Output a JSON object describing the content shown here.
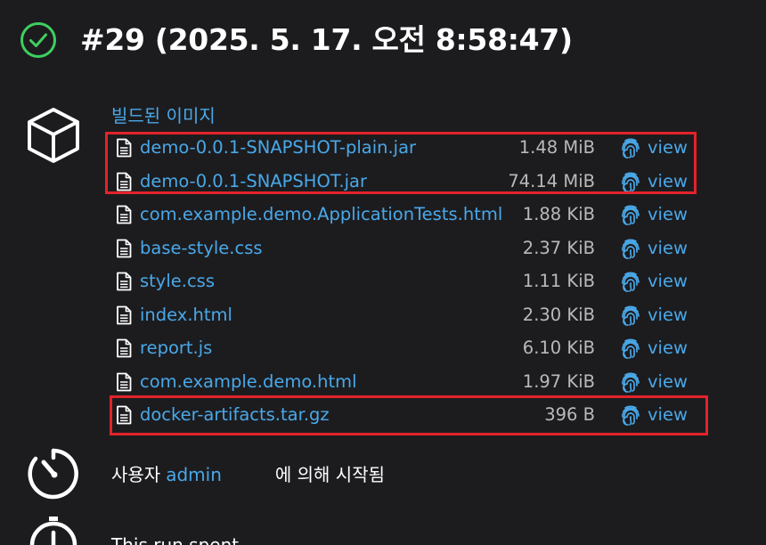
{
  "build": {
    "title": "#29 (2025. 5. 17. 오전 8:58:47)",
    "status": "success",
    "status_color": "#3fcf5f"
  },
  "artifacts": {
    "heading": "빌드된 이미지",
    "link_color": "#4aa8e8",
    "view_label": "view",
    "items": [
      {
        "name": "demo-0.0.1-SNAPSHOT-plain.jar",
        "size": "1.48 MiB",
        "icon": "file-icon"
      },
      {
        "name": "demo-0.0.1-SNAPSHOT.jar",
        "size": "74.14 MiB",
        "icon": "file-icon"
      },
      {
        "name": "com.example.demo.ApplicationTests.html",
        "size": "1.88 KiB",
        "icon": "file-icon"
      },
      {
        "name": "base-style.css",
        "size": "2.37 KiB",
        "icon": "file-icon"
      },
      {
        "name": "style.css",
        "size": "1.11 KiB",
        "icon": "file-icon"
      },
      {
        "name": "index.html",
        "size": "2.30 KiB",
        "icon": "file-icon"
      },
      {
        "name": "report.js",
        "size": "6.10 KiB",
        "icon": "file-icon"
      },
      {
        "name": "com.example.demo.html",
        "size": "1.97 KiB",
        "icon": "file-icon"
      },
      {
        "name": "docker-artifacts.tar.gz",
        "size": "396 B",
        "icon": "file-icon"
      }
    ]
  },
  "highlight_color": "#e3232b",
  "started_by": {
    "prefix": "사용자",
    "user": "admin",
    "suffix": "에 의해 시작됨"
  },
  "partial_text": "This run spent"
}
